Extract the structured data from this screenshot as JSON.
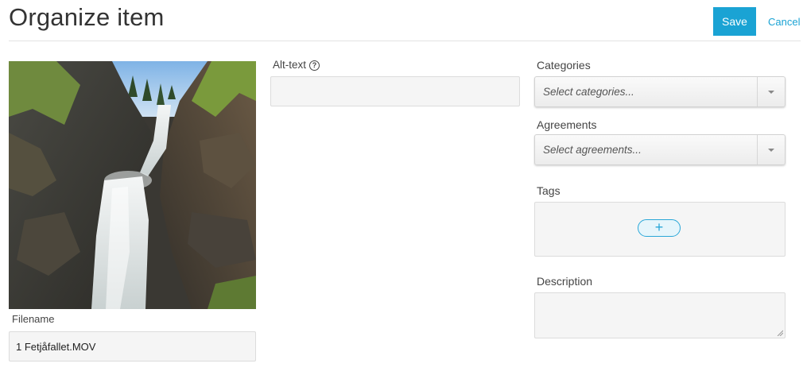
{
  "header": {
    "title": "Organize item",
    "save_label": "Save",
    "cancel_label": "Cancel"
  },
  "preview": {
    "filename_label": "Filename",
    "filename_value": "1 Fetjåfallet.MOV"
  },
  "alt_text": {
    "label": "Alt-text",
    "help_icon": "question-circle-icon",
    "value": ""
  },
  "categories": {
    "label": "Categories",
    "placeholder": "Select categories..."
  },
  "agreements": {
    "label": "Agreements",
    "placeholder": "Select agreements..."
  },
  "tags": {
    "label": "Tags",
    "add_label": "+"
  },
  "description": {
    "label": "Description",
    "value": ""
  },
  "colors": {
    "accent": "#1aa3d4",
    "field_bg": "#f5f5f5"
  }
}
